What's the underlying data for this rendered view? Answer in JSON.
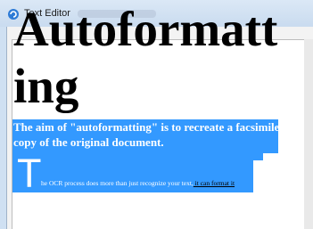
{
  "window": {
    "title": "Text Editor"
  },
  "document": {
    "heading": "Autoformatt ing",
    "subheading": "The aim of \"autoformatting\" is to recreate a facsimile copy of the original document.",
    "dropcap": "T",
    "body_selected": "he OCR process does more than just recognize your text,",
    "body_unselected": " it can format it"
  },
  "icons": {
    "app": "app-icon"
  },
  "colors": {
    "selection": "#3399ff",
    "titlebar": "#cfe0f2"
  }
}
